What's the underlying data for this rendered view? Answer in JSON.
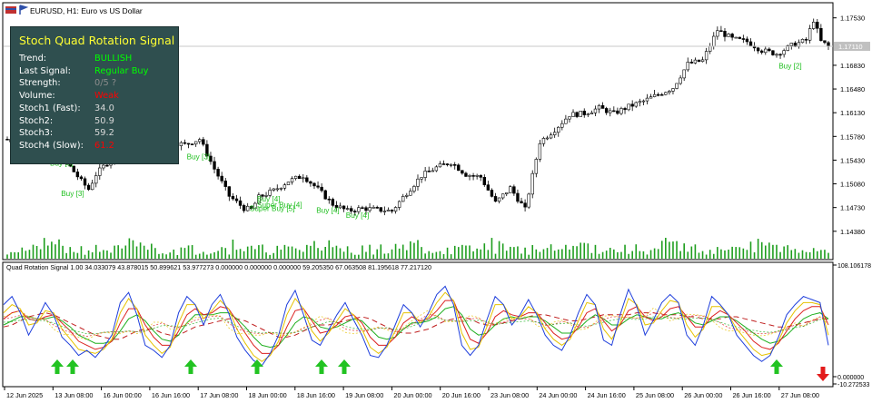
{
  "header": {
    "symbol": "EURUSD, H1: Euro vs US Dollar"
  },
  "indicator_header": "Quad Rotation Signal 1.00 34.033079 43.878015 50.899621 53.977273 0.000000 0.000000 0.000000 59.205350 67.063508 81.195618 77.217120",
  "info_panel": {
    "title": "Stoch Quad Rotation Signal",
    "rows": [
      {
        "label": "Trend:",
        "value": "BULLISH",
        "color": "#00ff00"
      },
      {
        "label": "Last Signal:",
        "value": "Regular Buy",
        "color": "#00ff00"
      },
      {
        "label": "Strength:",
        "value": "0/5 ?",
        "color": "#8c8c8c"
      },
      {
        "label": "Volume:",
        "value": "Weak",
        "color": "#ff0000"
      },
      {
        "label": "Stoch1 (Fast):",
        "value": "34.0",
        "color": "#d8d8d8"
      },
      {
        "label": "Stoch2:",
        "value": "50.9",
        "color": "#d8d8d8"
      },
      {
        "label": "Stoch3:",
        "value": "59.2",
        "color": "#d8d8d8"
      },
      {
        "label": "Stoch4 (Slow):",
        "value": "61.2",
        "color": "#ff0000"
      }
    ]
  },
  "colors": {
    "buy_label": "#1fbf1f",
    "buy_arrow": "#22c322",
    "sell_arrow": "#e31b1b",
    "volume": "#1e9e1e",
    "current_price_tag": "#c0c0c0"
  },
  "chart_data": [
    {
      "type": "candlestick",
      "title": "EURUSD, H1: Euro vs US Dollar",
      "y_ticks": [
        "1.17530",
        "1.16830",
        "1.16480",
        "1.16130",
        "1.15780",
        "1.15430",
        "1.15080",
        "1.14730",
        "1.14380"
      ],
      "ylim": [
        1.1423,
        1.1774
      ],
      "current_price": "1.17110",
      "x_ticks": [
        "12 Jun 2025",
        "13 Jun 08:00",
        "16 Jun 00:00",
        "16 Jun 16:00",
        "17 Jun 08:00",
        "18 Jun 00:00",
        "18 Jun 16:00",
        "19 Jun 08:00",
        "20 Jun 00:00",
        "20 Jun 16:00",
        "23 Jun 08:00",
        "24 Jun 00:00",
        "24 Jun 16:00",
        "25 Jun 08:00",
        "26 Jun 00:00",
        "26 Jun 16:00",
        "27 Jun 08:00"
      ],
      "close_path": [
        [
          0,
          1.1574
        ],
        [
          4,
          1.1566
        ],
        [
          8,
          1.1562
        ],
        [
          12,
          1.1552
        ],
        [
          16,
          1.154
        ],
        [
          20,
          1.1512
        ],
        [
          22,
          1.15
        ],
        [
          24,
          1.1522
        ],
        [
          28,
          1.1545
        ],
        [
          32,
          1.1555
        ],
        [
          36,
          1.1548
        ],
        [
          40,
          1.156
        ],
        [
          44,
          1.157
        ],
        [
          48,
          1.1566
        ],
        [
          52,
          1.1574
        ],
        [
          56,
          1.153
        ],
        [
          60,
          1.149
        ],
        [
          64,
          1.1472
        ],
        [
          66,
          1.147
        ],
        [
          68,
          1.1488
        ],
        [
          72,
          1.1498
        ],
        [
          76,
          1.1512
        ],
        [
          80,
          1.152
        ],
        [
          84,
          1.15
        ],
        [
          88,
          1.1478
        ],
        [
          92,
          1.1468
        ],
        [
          96,
          1.1472
        ],
        [
          100,
          1.147
        ],
        [
          104,
          1.1468
        ],
        [
          108,
          1.1495
        ],
        [
          112,
          1.152
        ],
        [
          116,
          1.1532
        ],
        [
          120,
          1.154
        ],
        [
          124,
          1.1522
        ],
        [
          128,
          1.1518
        ],
        [
          132,
          1.148
        ],
        [
          136,
          1.1502
        ],
        [
          140,
          1.147
        ],
        [
          144,
          1.157
        ],
        [
          148,
          1.1588
        ],
        [
          152,
          1.161
        ],
        [
          156,
          1.1612
        ],
        [
          160,
          1.162
        ],
        [
          164,
          1.1612
        ],
        [
          168,
          1.1622
        ],
        [
          172,
          1.163
        ],
        [
          176,
          1.164
        ],
        [
          180,
          1.165
        ],
        [
          184,
          1.1685
        ],
        [
          188,
          1.169
        ],
        [
          192,
          1.1735
        ],
        [
          196,
          1.1722
        ],
        [
          200,
          1.1718
        ],
        [
          204,
          1.1705
        ],
        [
          208,
          1.17
        ],
        [
          212,
          1.1712
        ],
        [
          216,
          1.172
        ],
        [
          218,
          1.175
        ],
        [
          220,
          1.1718
        ],
        [
          222,
          1.1711
        ]
      ],
      "labels": [
        {
          "text": "Buy [3]",
          "x": 14,
          "y": 1.1535
        },
        {
          "text": "Buy [3]",
          "x": 17,
          "y": 1.149
        },
        {
          "text": "Buy [3]",
          "x": 51,
          "y": 1.1544
        },
        {
          "text": "Buy [4]",
          "x": 70,
          "y": 1.1482
        },
        {
          "text": "Super Buy [4]",
          "x": 70,
          "y": 1.1473
        },
        {
          "text": "Super Buy [5]",
          "x": 68,
          "y": 1.1468
        },
        {
          "text": "Buy [4]",
          "x": 86,
          "y": 1.1465
        },
        {
          "text": "Buy [4]",
          "x": 94,
          "y": 1.1458
        },
        {
          "text": "Buy [2]",
          "x": 211,
          "y": 1.1678
        }
      ]
    },
    {
      "type": "line",
      "title": "Quad Rotation Signal 1.00",
      "ylim": [
        -10.272533,
        108.106178
      ],
      "y_ticks": [
        "108.106178",
        "0.000000",
        "-10.272533"
      ],
      "series": [
        {
          "color": "#1f3fdc",
          "values": [
            70,
            78,
            62,
            40,
            55,
            72,
            60,
            38,
            30,
            20,
            25,
            18,
            28,
            40,
            72,
            82,
            60,
            30,
            25,
            18,
            30,
            62,
            78,
            70,
            50,
            70,
            80,
            62,
            38,
            25,
            15,
            10,
            22,
            40,
            70,
            84,
            60,
            35,
            30,
            45,
            60,
            72,
            55,
            40,
            20,
            18,
            30,
            50,
            70,
            62,
            48,
            62,
            80,
            88,
            70,
            30,
            20,
            30,
            55,
            78,
            70,
            50,
            60,
            75,
            60,
            40,
            30,
            25,
            40,
            62,
            80,
            70,
            35,
            30,
            60,
            85,
            68,
            40,
            55,
            72,
            80,
            72,
            40,
            30,
            50,
            78,
            70,
            60,
            40,
            30,
            20,
            14,
            20,
            38,
            60,
            70,
            78,
            75,
            72,
            30
          ]
        },
        {
          "color": "#e6c200",
          "values": [
            62,
            70,
            66,
            50,
            52,
            64,
            62,
            46,
            36,
            26,
            24,
            22,
            26,
            36,
            62,
            76,
            66,
            40,
            30,
            22,
            28,
            52,
            70,
            70,
            56,
            64,
            74,
            66,
            46,
            32,
            20,
            14,
            20,
            34,
            60,
            76,
            66,
            44,
            34,
            42,
            54,
            66,
            60,
            46,
            28,
            22,
            28,
            44,
            62,
            62,
            52,
            58,
            72,
            82,
            74,
            42,
            26,
            28,
            48,
            70,
            70,
            56,
            58,
            68,
            62,
            46,
            36,
            30,
            36,
            54,
            72,
            70,
            46,
            36,
            52,
            76,
            70,
            50,
            52,
            64,
            74,
            72,
            50,
            38,
            46,
            68,
            68,
            60,
            46,
            36,
            26,
            20,
            22,
            34,
            52,
            64,
            72,
            72,
            70,
            40
          ]
        },
        {
          "color": "#dc2020",
          "values": [
            56,
            62,
            64,
            56,
            54,
            58,
            60,
            52,
            44,
            34,
            30,
            26,
            28,
            34,
            52,
            66,
            66,
            50,
            38,
            30,
            30,
            44,
            60,
            66,
            60,
            62,
            68,
            66,
            54,
            42,
            30,
            22,
            22,
            30,
            48,
            64,
            66,
            54,
            42,
            44,
            50,
            58,
            60,
            52,
            38,
            30,
            30,
            38,
            52,
            58,
            54,
            56,
            64,
            74,
            74,
            54,
            36,
            32,
            42,
            58,
            64,
            60,
            58,
            62,
            62,
            52,
            42,
            36,
            38,
            48,
            62,
            66,
            54,
            44,
            50,
            64,
            68,
            58,
            54,
            58,
            66,
            68,
            58,
            48,
            48,
            58,
            64,
            60,
            52,
            44,
            34,
            28,
            26,
            32,
            44,
            56,
            64,
            68,
            68,
            50
          ]
        },
        {
          "color": "#20b020",
          "values": [
            50,
            54,
            58,
            58,
            56,
            56,
            58,
            54,
            48,
            40,
            36,
            32,
            32,
            34,
            44,
            56,
            60,
            54,
            44,
            36,
            34,
            40,
            52,
            60,
            60,
            60,
            62,
            62,
            56,
            48,
            38,
            30,
            28,
            30,
            40,
            52,
            58,
            56,
            48,
            46,
            48,
            52,
            56,
            54,
            46,
            38,
            36,
            38,
            46,
            52,
            52,
            54,
            58,
            66,
            68,
            60,
            46,
            40,
            42,
            50,
            56,
            58,
            56,
            58,
            58,
            54,
            48,
            42,
            42,
            46,
            54,
            60,
            56,
            50,
            50,
            56,
            60,
            58,
            56,
            56,
            60,
            62,
            58,
            52,
            50,
            54,
            58,
            58,
            54,
            48,
            42,
            36,
            32,
            34,
            40,
            48,
            56,
            60,
            62,
            56
          ]
        }
      ],
      "dashed_series": [
        {
          "color": "#c02020",
          "values": [
            48,
            50,
            54,
            58,
            60,
            62,
            60,
            56,
            52,
            48,
            44,
            40,
            38,
            36,
            36,
            40,
            44,
            46,
            46,
            42,
            40,
            40,
            44,
            48,
            50,
            52,
            54,
            56,
            56,
            54,
            50,
            46,
            42,
            38,
            38,
            40,
            44,
            48,
            50,
            50,
            52,
            54,
            56,
            58,
            56,
            52,
            48,
            44,
            42,
            42,
            44,
            46,
            50,
            54,
            56,
            58,
            56,
            52,
            50,
            50,
            52,
            54,
            56,
            58,
            60,
            60,
            58,
            56,
            54,
            54,
            56,
            58,
            60,
            60,
            60,
            60,
            62,
            62,
            62,
            60,
            60,
            60,
            58,
            58,
            56,
            56,
            56,
            58,
            58,
            56,
            54,
            52,
            50,
            48,
            48,
            50,
            52,
            54,
            56,
            56
          ]
        }
      ],
      "arrows": [
        {
          "kind": "buy",
          "x": 63
        },
        {
          "kind": "buy",
          "x": 80
        },
        {
          "kind": "buy",
          "x": 210
        },
        {
          "kind": "buy",
          "x": 283
        },
        {
          "kind": "buy",
          "x": 354
        },
        {
          "kind": "buy",
          "x": 379
        },
        {
          "kind": "buy",
          "x": 855
        },
        {
          "kind": "sell",
          "x": 906
        }
      ]
    }
  ]
}
